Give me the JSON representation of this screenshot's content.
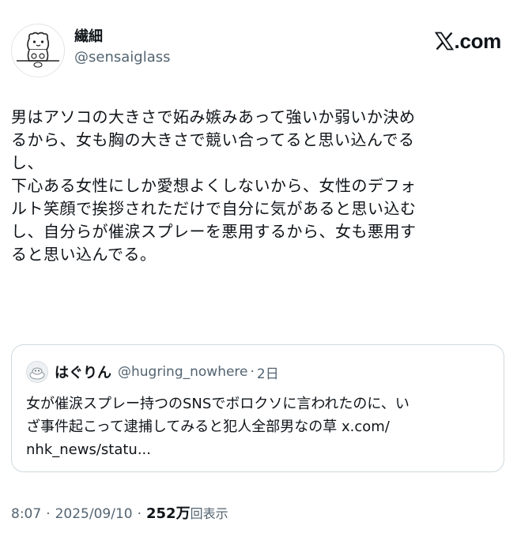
{
  "colors": {
    "text_primary": "#0f1419",
    "text_secondary": "#536471",
    "border": "#cfd9de",
    "background": "#ffffff"
  },
  "author": {
    "display_name": "繊細",
    "handle": "@sensaiglass",
    "avatar_icon": "cartoon-character-avatar"
  },
  "brand": {
    "logo_icon": "x-logo-icon",
    "suffix": ".com"
  },
  "tweet": {
    "lines": [
      "男はアソコの大きさで妬み嫉みあって強いか弱いか決め",
      "るから、女も胸の大きさで競い合ってると思い込んでる",
      "し、",
      "下心ある女性にしか愛想よくしないから、女性のデフォ",
      "ルト笑顔で挨拶されただけで自分に気があると思い込む",
      "し、自分らが催涙スプレーを悪用するから、女も悪用す",
      "ると思い込んでる。"
    ]
  },
  "quote": {
    "display_name": "はぐりん",
    "handle": "@hugring_nowhere",
    "separator": "·",
    "time": "2日",
    "avatar_icon": "small-avatar-icon",
    "lines": [
      "女が催涙スプレー持つのSNSでボロクソに言われたのに、い",
      "ざ事件起こって逮捕してみると犯人全部男なの草 x.com/",
      "nhk_news/statu..."
    ]
  },
  "meta": {
    "time": "8:07",
    "separator": "·",
    "date": "2025/09/10",
    "views_number": "252",
    "views_unit": "万",
    "views_label": "回表示"
  }
}
